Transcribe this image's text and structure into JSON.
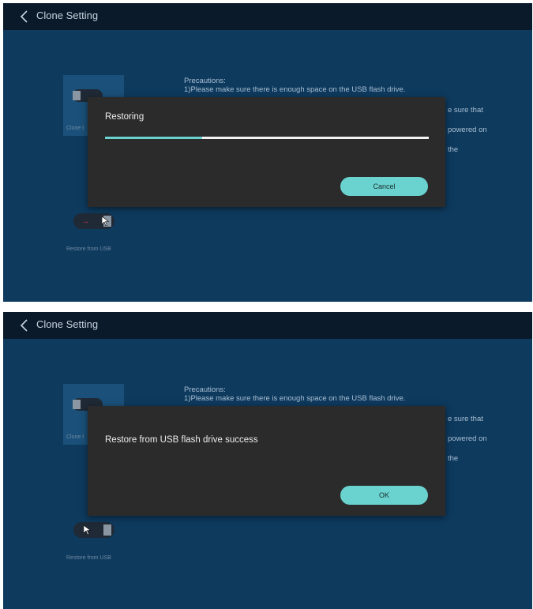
{
  "screens": [
    {
      "header": {
        "title": "Clone Setting",
        "back_icon": "chevron-left-icon"
      },
      "clone_tile": {
        "label": "Clone t",
        "icon": "usb-drive-icon"
      },
      "precautions": {
        "title": "Precautions:",
        "line1": "1)Please make sure there is enough space on the USB flash drive.",
        "partial_lines": [
          "e sure that",
          "powered on",
          "the"
        ]
      },
      "restore": {
        "label": "Restore from USB",
        "icon": "usb-restore-icon"
      },
      "dialog": {
        "message": "Restoring",
        "progress": 0.3,
        "button_label": "Cancel"
      },
      "colors": {
        "accent": "#6ad3cf",
        "background": "#0e3a5e",
        "header": "#0a1a2b",
        "dialog": "#2b2b2b"
      }
    },
    {
      "header": {
        "title": "Clone Setting",
        "back_icon": "chevron-left-icon"
      },
      "clone_tile": {
        "label": "Clone t",
        "icon": "usb-drive-icon"
      },
      "precautions": {
        "title": "Precautions:",
        "line1": "1)Please make sure there is enough space on the USB flash drive.",
        "partial_lines": [
          "e sure that",
          "powered on",
          "the"
        ]
      },
      "restore": {
        "label": "Restore from USB",
        "icon": "usb-restore-icon"
      },
      "dialog": {
        "message": "Restore from USB flash drive success",
        "button_label": "OK"
      },
      "colors": {
        "accent": "#6ad3cf",
        "background": "#0e3a5e",
        "header": "#0a1a2b",
        "dialog": "#2b2b2b"
      }
    }
  ]
}
